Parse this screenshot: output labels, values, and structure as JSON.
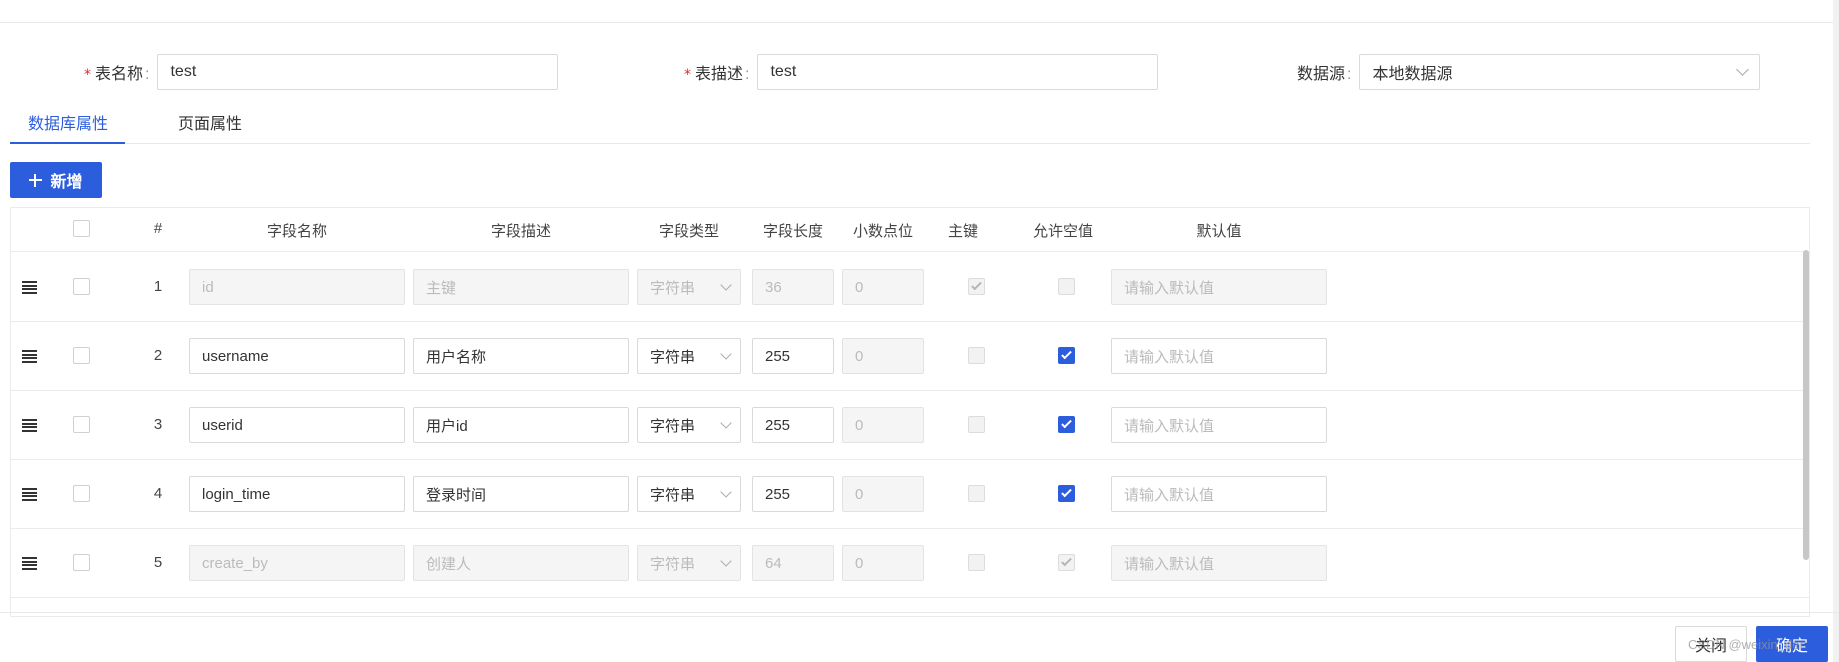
{
  "form": {
    "table_name": {
      "label": "表名称",
      "value": "test"
    },
    "table_desc": {
      "label": "表描述",
      "value": "test"
    },
    "datasource": {
      "label": "数据源",
      "value": "本地数据源"
    }
  },
  "tabs": [
    {
      "label": "数据库属性",
      "active": true
    },
    {
      "label": "页面属性",
      "active": false
    }
  ],
  "add_button": {
    "label": "新增"
  },
  "columns": [
    "#",
    "字段名称",
    "字段描述",
    "字段类型",
    "字段长度",
    "小数点位",
    "主键",
    "允许空值",
    "默认值"
  ],
  "default_placeholder": "请输入默认值",
  "rows": [
    {
      "num": "1",
      "name": "id",
      "desc": "主键",
      "type": "字符串",
      "length": "36",
      "decimal": "0",
      "pk": true,
      "nullable": false,
      "disabled": true
    },
    {
      "num": "2",
      "name": "username",
      "desc": "用户名称",
      "type": "字符串",
      "length": "255",
      "decimal": "0",
      "pk": false,
      "nullable": true,
      "disabled": false
    },
    {
      "num": "3",
      "name": "userid",
      "desc": "用户id",
      "type": "字符串",
      "length": "255",
      "decimal": "0",
      "pk": false,
      "nullable": true,
      "disabled": false
    },
    {
      "num": "4",
      "name": "login_time",
      "desc": "登录时间",
      "type": "字符串",
      "length": "255",
      "decimal": "0",
      "pk": false,
      "nullable": true,
      "disabled": false
    },
    {
      "num": "5",
      "name": "create_by",
      "desc": "创建人",
      "type": "字符串",
      "length": "64",
      "decimal": "0",
      "pk": false,
      "nullable": true,
      "disabled": true
    }
  ],
  "footer": {
    "close_label": "关闭",
    "ok_label": "确定",
    "watermark": "CSDN @weixin_der"
  },
  "colors": {
    "primary": "#2c5ddc",
    "required": "#f5222d"
  },
  "icons": {
    "drag": "drag-handle-icon",
    "add": "plus-icon",
    "select": "chevron-down-icon",
    "check": "check-icon"
  }
}
